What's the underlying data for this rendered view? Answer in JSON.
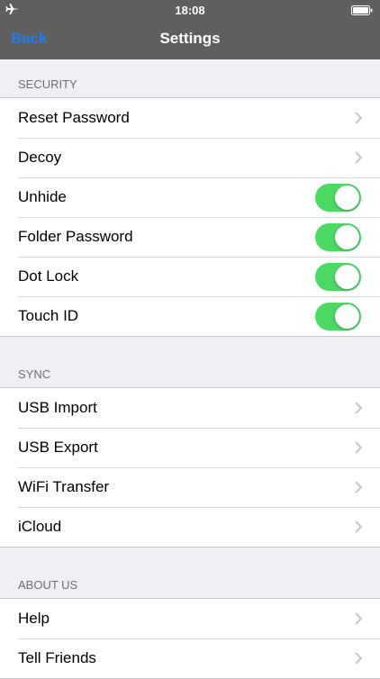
{
  "status": {
    "time": "18:08",
    "airplane_icon": "airplane-icon",
    "battery_icon": "battery-icon"
  },
  "nav": {
    "back_label": "Back",
    "title": "Settings",
    "back_color": "#1e7cf0"
  },
  "sections": {
    "security": {
      "header": "SECURITY",
      "items": [
        {
          "label": "Reset Password",
          "control": "chevron"
        },
        {
          "label": "Decoy",
          "control": "chevron"
        },
        {
          "label": "Unhide",
          "control": "toggle",
          "on": true
        },
        {
          "label": "Folder Password",
          "control": "toggle",
          "on": true
        },
        {
          "label": "Dot Lock",
          "control": "toggle",
          "on": true
        },
        {
          "label": "Touch ID",
          "control": "toggle",
          "on": true
        }
      ]
    },
    "sync": {
      "header": "SYNC",
      "items": [
        {
          "label": "USB Import",
          "control": "chevron"
        },
        {
          "label": "USB Export",
          "control": "chevron"
        },
        {
          "label": "WiFi Transfer",
          "control": "chevron"
        },
        {
          "label": "iCloud",
          "control": "chevron"
        }
      ]
    },
    "about": {
      "header": "ABOUT US",
      "items": [
        {
          "label": "Help",
          "control": "chevron"
        },
        {
          "label": "Tell Friends",
          "control": "chevron"
        }
      ]
    }
  },
  "colors": {
    "toggle_on": "#4cd964",
    "bar": "#5f5f5f",
    "background": "#efeff4"
  }
}
